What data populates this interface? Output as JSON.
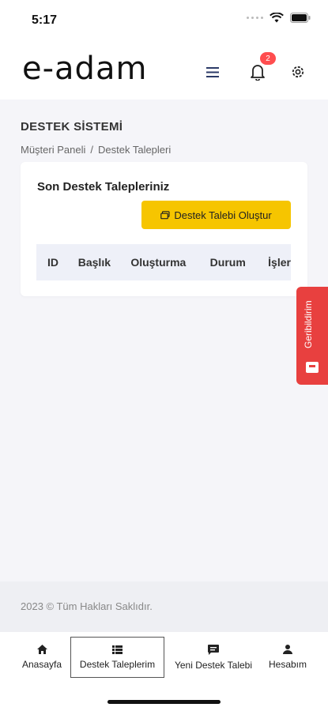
{
  "status_bar": {
    "time": "5:17"
  },
  "header": {
    "logo": "e-adam",
    "notification_count": "2"
  },
  "page": {
    "title": "DESTEK SİSTEMİ",
    "breadcrumb": [
      "Müşteri Paneli",
      "/",
      "Destek Talepleri"
    ]
  },
  "card": {
    "title": "Son Destek Talepleriniz",
    "create_button": "Destek Talebi Oluştur",
    "table_headers": [
      "ID",
      "Başlık",
      "Oluşturma",
      "Durum",
      "İşler"
    ]
  },
  "feedback_tab": {
    "label": "Geribildirim"
  },
  "footer": {
    "text": "2023 © Tüm Hakları Saklıdır."
  },
  "bottom_nav": [
    {
      "label": "Anasayfa",
      "icon": "home-icon"
    },
    {
      "label": "Destek Taleplerim",
      "icon": "list-icon"
    },
    {
      "label": "Yeni Destek Talebi",
      "icon": "chat-icon"
    },
    {
      "label": "Hesabım",
      "icon": "user-icon"
    }
  ],
  "colors": {
    "accent": "#f6c500",
    "badge": "#ff4d4f",
    "feedback": "#e8403f"
  }
}
